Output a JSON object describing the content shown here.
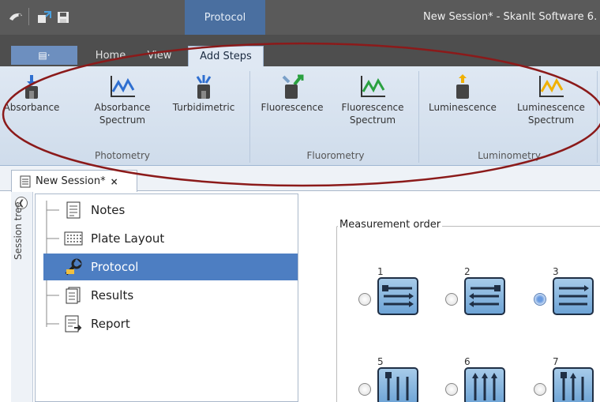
{
  "titlebar": {
    "context_tab": "Protocol",
    "window_title": "New Session* - SkanIt Software 6."
  },
  "ribbon_tabs": [
    {
      "label": "Home"
    },
    {
      "label": "View"
    },
    {
      "label": "Add Steps"
    }
  ],
  "ribbon": {
    "buttons": [
      {
        "label": "Absorbance",
        "icon": "absorbance-icon"
      },
      {
        "label": "Absorbance Spectrum",
        "icon": "absorbance-spectrum-icon"
      },
      {
        "label": "Turbidimetric",
        "icon": "turbidimetric-icon"
      },
      {
        "label": "Fluorescence",
        "icon": "fluorescence-icon"
      },
      {
        "label": "Fluorescence Spectrum",
        "icon": "fluorescence-spectrum-icon"
      },
      {
        "label": "Luminescence",
        "icon": "luminescence-icon"
      },
      {
        "label": "Luminescence Spectrum",
        "icon": "luminescence-spectrum-icon"
      }
    ],
    "groups": [
      "Photometry",
      "Fluorometry",
      "Luminometry"
    ]
  },
  "doc_tab": {
    "label": "New Session*",
    "close": "×"
  },
  "session_tree": {
    "rail_label": "Session tree",
    "items": [
      {
        "label": "Notes",
        "icon": "notes-icon"
      },
      {
        "label": "Plate Layout",
        "icon": "plate-layout-icon"
      },
      {
        "label": "Protocol",
        "icon": "protocol-wrench-icon",
        "selected": true
      },
      {
        "label": "Results",
        "icon": "results-icon"
      },
      {
        "label": "Report",
        "icon": "report-icon"
      }
    ]
  },
  "measurement_order": {
    "legend": "Measurement order",
    "options": [
      {
        "num": "1",
        "selected": false
      },
      {
        "num": "2",
        "selected": false
      },
      {
        "num": "3",
        "selected": true
      },
      {
        "num": "5",
        "selected": false
      },
      {
        "num": "6",
        "selected": false
      },
      {
        "num": "7",
        "selected": false
      }
    ]
  },
  "colors": {
    "annotation": "#8b1a1a",
    "selection": "#4d7ec2",
    "context_tab": "#4a6fa0"
  }
}
